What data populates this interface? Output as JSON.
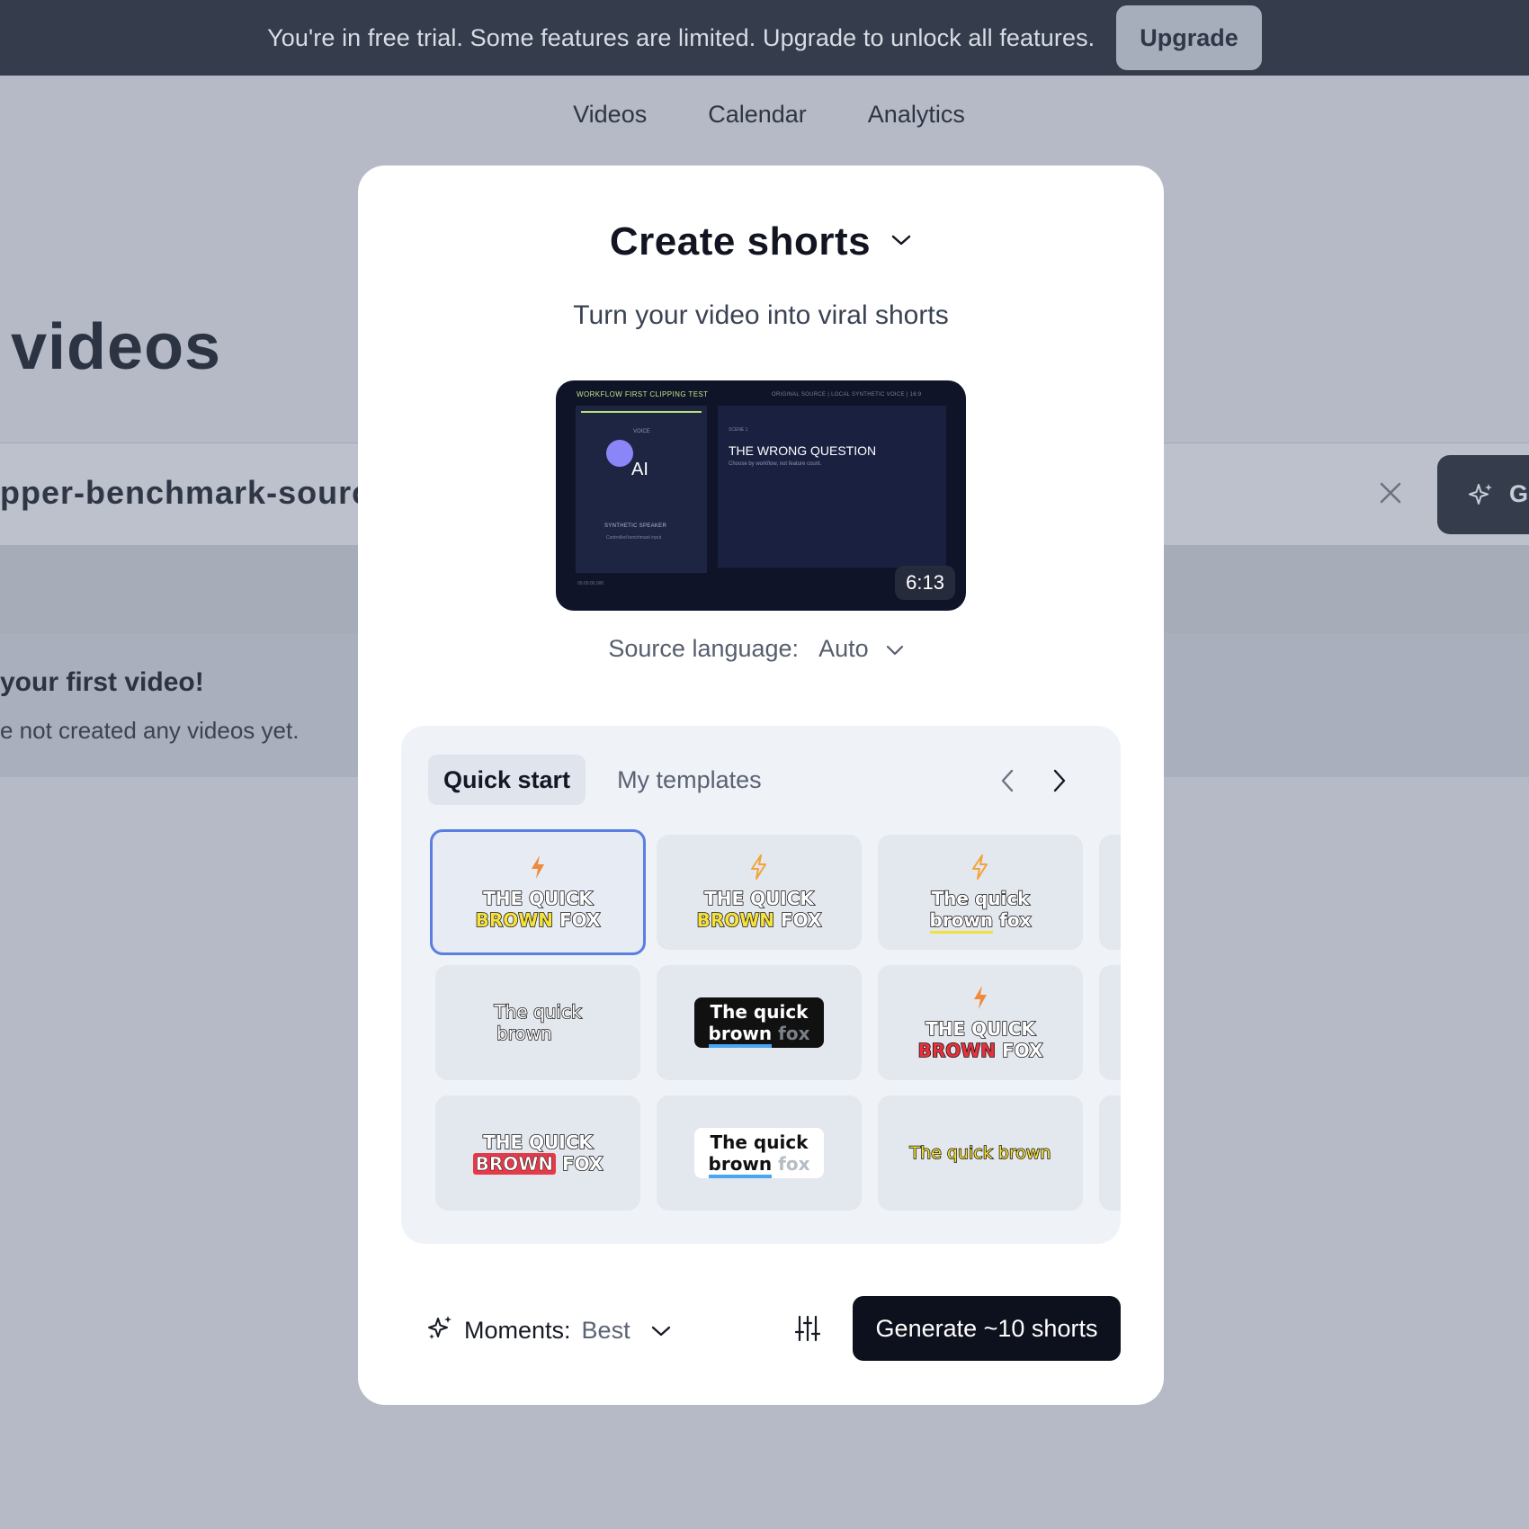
{
  "banner": {
    "text": "You're in free trial. Some features are limited. Upgrade to unlock all features.",
    "upgrade_label": "Upgrade"
  },
  "top_nav": {
    "items": [
      {
        "label": "Videos"
      },
      {
        "label": "Calendar"
      },
      {
        "label": "Analytics"
      }
    ]
  },
  "background": {
    "page_title": "videos",
    "file_name": "pper-benchmark-source",
    "generate_letter": "G",
    "empty_title": "your first video!",
    "empty_subtitle": "e not created any videos yet."
  },
  "modal": {
    "title": "Create shorts",
    "subtitle": "Turn your video into viral shorts",
    "video": {
      "duration": "6:13",
      "top_left": "WORKFLOW FIRST CLIPPING TEST",
      "top_right": "ORIGINAL SOURCE | LOCAL SYNTHETIC VOICE | 16:9",
      "voice_label": "VOICE",
      "ai_label": "AI",
      "speaker_label": "SYNTHETIC SPEAKER",
      "speaker_sub": "Controlled benchmark input",
      "scene_label": "SCENE 1",
      "heading": "THE WRONG QUESTION",
      "heading_sub": "Choose by workflow, not feature count.",
      "timestamp": "00:00:00.000"
    },
    "source_language": {
      "label": "Source language:",
      "value": "Auto"
    },
    "templates": {
      "tabs": [
        {
          "label": "Quick start",
          "active": true
        },
        {
          "label": "My templates",
          "active": false
        }
      ],
      "caption_words": {
        "upper_1": "THE QUICK",
        "upper_2a": "BROWN",
        "upper_2b": "FOX",
        "lower_1": "The quick",
        "lower_2": "brown fox",
        "lower_brown": "brown",
        "lower_fox": "fox",
        "lower_line": "The quick brown"
      },
      "accent_colors": {
        "selected_border": "#5b7fe0",
        "yellow": "#f6e23a",
        "red": "#e53a4a",
        "blue_underline": "#4aa6f0",
        "bolt_orange": "#f08a3a"
      }
    },
    "footer": {
      "moments_label": "Moments:",
      "moments_value": "Best",
      "generate_label": "Generate ~10 shorts"
    }
  }
}
